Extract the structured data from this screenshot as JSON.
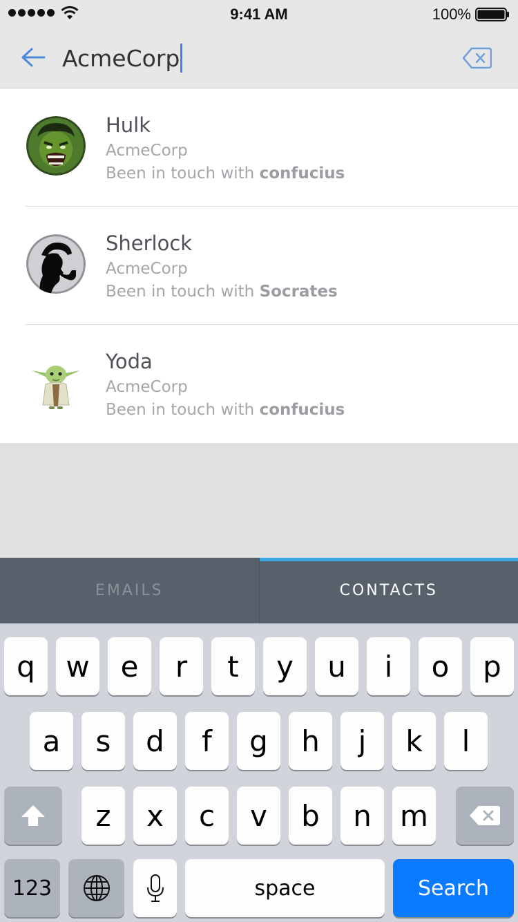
{
  "status_bar": {
    "time": "9:41 AM",
    "battery": "100%"
  },
  "search": {
    "query": "AcmeCorp"
  },
  "results": [
    {
      "name": "Hulk",
      "org": "AcmeCorp",
      "touch_prefix": "Been in touch with ",
      "touch_name": "confucius",
      "avatar": "hulk-avatar"
    },
    {
      "name": "Sherlock",
      "org": "AcmeCorp",
      "touch_prefix": "Been in touch with ",
      "touch_name": "Socrates",
      "avatar": "sherlock-avatar"
    },
    {
      "name": "Yoda",
      "org": "AcmeCorp",
      "touch_prefix": "Been in touch with ",
      "touch_name": "confucius",
      "avatar": "yoda-avatar"
    }
  ],
  "tabs": {
    "emails": "EMAILS",
    "contacts": "CONTACTS",
    "active": "contacts"
  },
  "keyboard": {
    "row1": [
      "q",
      "w",
      "e",
      "r",
      "t",
      "y",
      "u",
      "i",
      "o",
      "p"
    ],
    "row2": [
      "a",
      "s",
      "d",
      "f",
      "g",
      "h",
      "j",
      "k",
      "l"
    ],
    "row3": [
      "z",
      "x",
      "c",
      "v",
      "b",
      "n",
      "m"
    ],
    "numbers": "123",
    "space": "space",
    "search": "Search"
  },
  "colors": {
    "accent": "#3aa9e6",
    "search_key": "#0a7bff",
    "tab_bar": "#58616b"
  }
}
